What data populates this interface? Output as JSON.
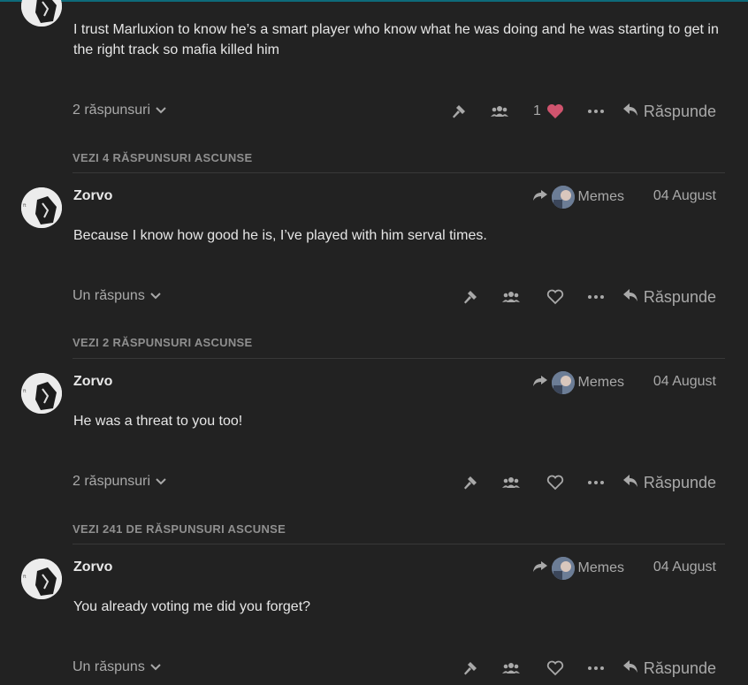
{
  "posts": [
    {
      "username": "",
      "reply_to": "",
      "date": "",
      "body": "I trust Marluxion to know he’s a smart player who know what he was doing and he was starting to get in the right track so mafia killed him",
      "replies_label": "2 răspunsuri",
      "like_count": "1",
      "reply_label": "Răspunde"
    },
    {
      "username": "Zorvo",
      "reply_to": "Memes",
      "date": "04 August",
      "body": "Because I know how good he is, I’ve played with him serval times.",
      "replies_label": "Un răspuns",
      "like_count": "",
      "reply_label": "Răspunde"
    },
    {
      "username": "Zorvo",
      "reply_to": "Memes",
      "date": "04 August",
      "body": "He was a threat to you too!",
      "replies_label": "2 răspunsuri",
      "like_count": "",
      "reply_label": "Răspunde"
    },
    {
      "username": "Zorvo",
      "reply_to": "Memes",
      "date": "04 August",
      "body": "You already voting me did you forget?",
      "replies_label": "Un răspuns",
      "like_count": "",
      "reply_label": "Răspunde"
    }
  ],
  "hidden_replies": [
    "VEZI 4 RĂSPUNSURI ASCUNSE",
    "VEZI 2 RĂSPUNSURI ASCUNSE",
    "VEZI 241 DE RĂSPUNSURI ASCUNSE"
  ],
  "colors": {
    "background": "#222222",
    "text": "#e6e6e6",
    "muted": "#a9a9a9",
    "like_heart": "#d0546e",
    "top_accent": "#0e6b7b"
  },
  "icons": [
    "hammer-icon",
    "group-icon",
    "heart-icon",
    "more-icon",
    "reply-arrow-icon",
    "share-arrow-icon",
    "chevron-down-icon"
  ]
}
